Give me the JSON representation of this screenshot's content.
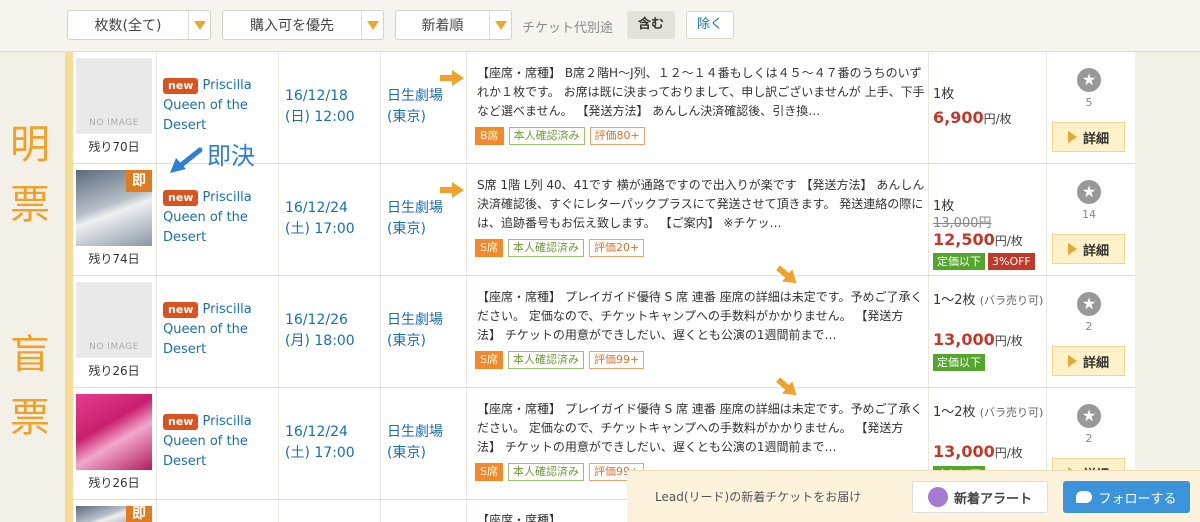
{
  "toolbar": {
    "filter_count": "枚数(全て)",
    "filter_priority": "購入可を優先",
    "filter_sort": "新着順",
    "ticket_fee_label": "チケット代別途",
    "include_label": "含む",
    "exclude_label": "除く"
  },
  "side_labels": {
    "top": [
      "明",
      "票"
    ],
    "bottom": [
      "盲",
      "票"
    ]
  },
  "annotation": {
    "label": "即決",
    "arrow": "blue-arrow-icon"
  },
  "listings": [
    {
      "image": "NO IMAGE",
      "remaining": "残り70日",
      "new_badge": "new",
      "title": "Priscilla Queen of the Desert",
      "date": "16/12/18",
      "time": "(日) 12:00",
      "venue": "日生劇場",
      "venue_city": "(東京)",
      "description": "【座席・席種】 B席２階H～J列、１２～１４番もしくは４５～４７番のうちのいずれか１枚です。 お席は既に決まっておりまして、申し訳ございませんが 上手、下手など選べません。 【発送方法】 あんしん決済確認後、引き換…",
      "tags": [
        "B席",
        "本人確認済み",
        "評価80+"
      ],
      "quantity": "1枚",
      "original_price": "",
      "price": "6,900",
      "price_unit": "円/枚",
      "badges": [],
      "favorites": "5",
      "detail_label": "詳細"
    },
    {
      "image": "photo",
      "instant_badge": "即",
      "remaining": "残り74日",
      "new_badge": "new",
      "title": "Priscilla Queen of the Desert",
      "date": "16/12/24",
      "time": "(土) 17:00",
      "venue": "日生劇場",
      "venue_city": "(東京)",
      "description": "S席 1階 L列 40、41です 横が通路ですので出入りが楽です 【発送方法】 あんしん決済確認後、すぐにレターパックプラスにて発送させて頂きます。 発送連絡の際には、追跡番号もお伝え致します。 【ご案内】 ※チケッ…",
      "tags": [
        "S席",
        "本人確認済み",
        "評価20+"
      ],
      "quantity": "1枚",
      "original_price": "13,000円",
      "price": "12,500",
      "price_unit": "円/枚",
      "badges": [
        "定価以下",
        "3%OFF"
      ],
      "favorites": "14",
      "detail_label": "詳細"
    },
    {
      "image": "NO IMAGE",
      "remaining": "残り26日",
      "new_badge": "new",
      "title": "Priscilla Queen of the Desert",
      "date": "16/12/26",
      "time": "(月) 18:00",
      "venue": "日生劇場",
      "venue_city": "(東京)",
      "description": "【座席・席種】 プレイガイド優待 S 席 連番 座席の詳細は未定です。予めご了承ください。 定価なので、チケットキャンプへの手数料がかかりません。 【発送方法】 チケットの用意ができしだい、遅くとも公演の1週間前まで…",
      "tags": [
        "S席",
        "本人確認済み",
        "評価99+"
      ],
      "quantity": "1～2枚",
      "quantity_note": "(バラ売り可)",
      "original_price": "",
      "price": "13,000",
      "price_unit": "円/枚",
      "badges": [
        "定価以下"
      ],
      "favorites": "2",
      "detail_label": "詳細"
    },
    {
      "image": "poster",
      "remaining": "残り26日",
      "new_badge": "new",
      "title": "Priscilla Queen of the Desert",
      "date": "16/12/24",
      "time": "(土) 17:00",
      "venue": "日生劇場",
      "venue_city": "(東京)",
      "description": "【座席・席種】 プレイガイド優待 S 席 連番 座席の詳細は未定です。予めご了承ください。 定価なので、チケットキャンプへの手数料がかかりません。 【発送方法】 チケットの用意ができしだい、遅くとも公演の1週間前まで…",
      "tags": [
        "S席",
        "本人確認済み",
        "評価99+"
      ],
      "quantity": "1～2枚",
      "quantity_note": "(バラ売り可)",
      "original_price": "",
      "price": "13,000",
      "price_unit": "円/枚",
      "badges": [
        "定価以下"
      ],
      "favorites": "2",
      "detail_label": "詳細"
    }
  ],
  "partial_row": {
    "instant_badge": "即",
    "description": "【座席・席種】"
  },
  "bottom_bar": {
    "text": "Lead(リード)の新着チケットをお届け",
    "alert_button": "新着アラート",
    "follow_button": "フォローする"
  },
  "colors": {
    "accent": "#f0a12a",
    "link": "#1a6fb0",
    "price": "#c0392b",
    "green": "#52a62c"
  }
}
